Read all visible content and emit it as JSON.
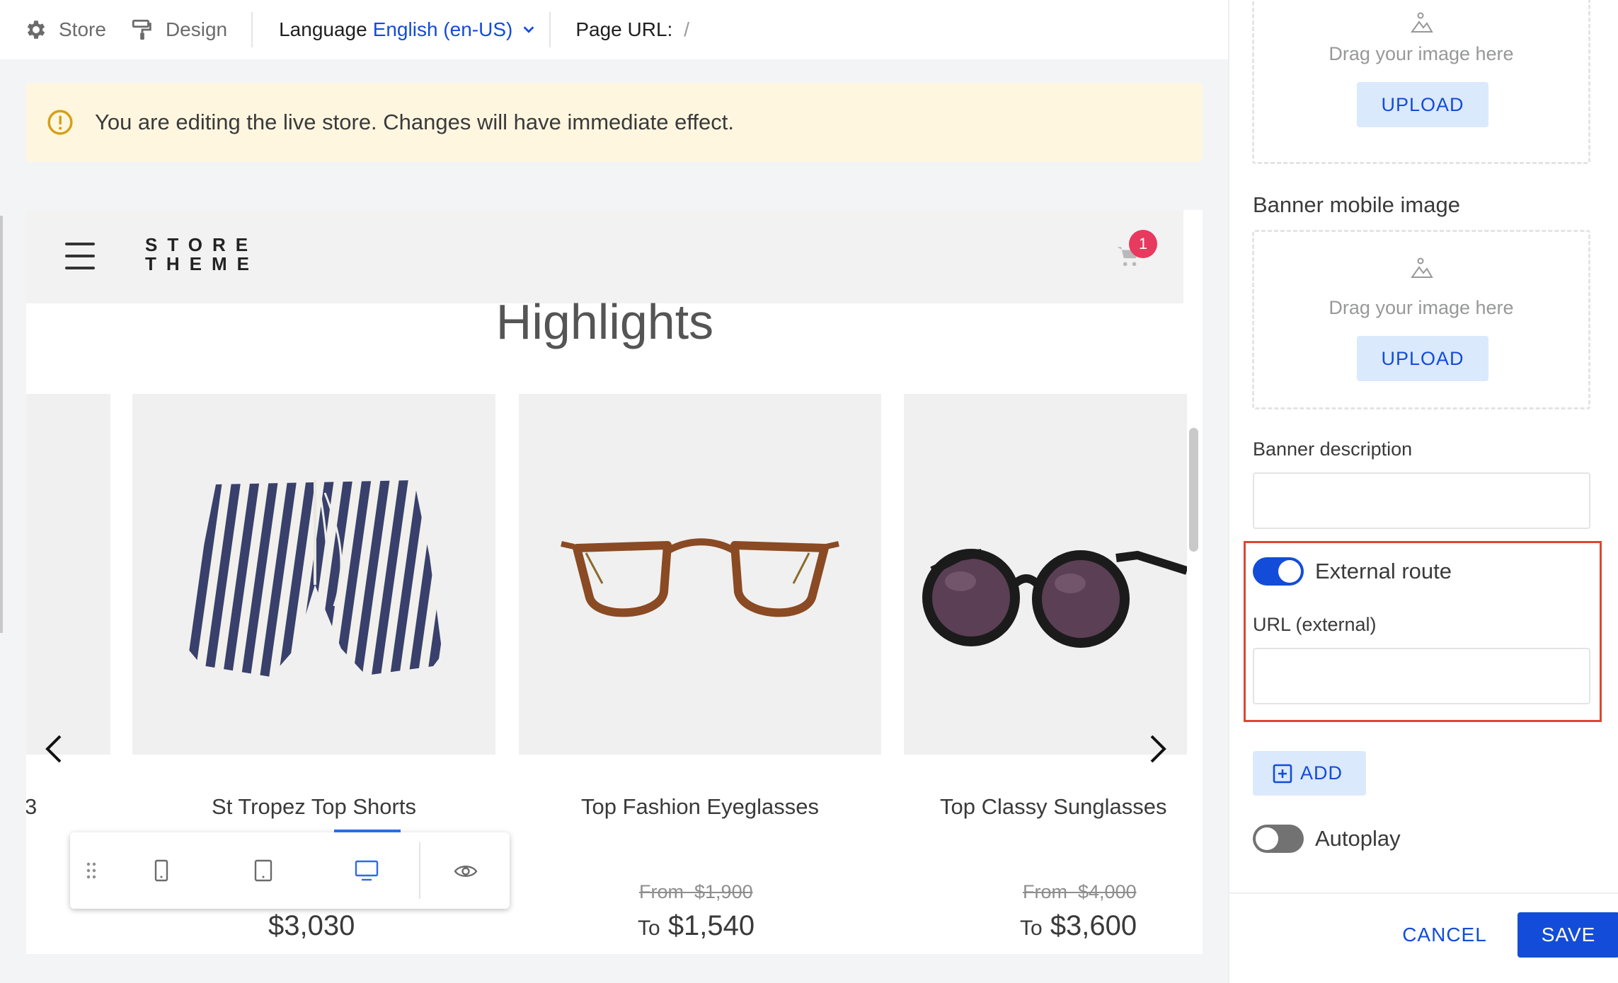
{
  "topbar": {
    "store_label": "Store",
    "design_label": "Design",
    "language_label": "Language",
    "language_value": "English (en-US)",
    "page_url_label": "Page URL:",
    "page_url_value": "/"
  },
  "warning": {
    "text": "You are editing the live store. Changes will have immediate effect."
  },
  "preview": {
    "logo_line1": "STORE",
    "logo_line2": "THEME",
    "cart_count": "1",
    "section_title": "Highlights",
    "products": [
      {
        "name": "3",
        "from_label": "",
        "from_price": "",
        "to_label": "",
        "price": ""
      },
      {
        "name": "St Tropez Top Shorts",
        "from_label": "",
        "from_price": "",
        "to_label": "",
        "price": "$3,030"
      },
      {
        "name": "Top Fashion Eyeglasses",
        "from_label": "From",
        "from_price": "$1,900",
        "to_label": "To",
        "price": "$1,540"
      },
      {
        "name": "Top Classy Sunglasses",
        "from_label": "From",
        "from_price": "$4,000",
        "to_label": "To",
        "price": "$3,600"
      }
    ],
    "device_toolbar": {
      "active": "desktop"
    }
  },
  "panel": {
    "dropzone_text": "Drag your image here",
    "upload_label": "UPLOAD",
    "banner_mobile_label": "Banner mobile image",
    "banner_description_label": "Banner description",
    "banner_description_value": "",
    "external_route_label": "External route",
    "external_route_on": true,
    "url_external_label": "URL (external)",
    "url_external_value": "",
    "add_label": "ADD",
    "autoplay_label": "Autoplay",
    "autoplay_on": false,
    "cancel_label": "CANCEL",
    "save_label": "SAVE"
  },
  "colors": {
    "accent": "#134cd8",
    "warning_bg": "#fff6e0",
    "warning_icon": "#d4a017",
    "highlight_box": "#e0462f",
    "badge": "#e8395f"
  }
}
